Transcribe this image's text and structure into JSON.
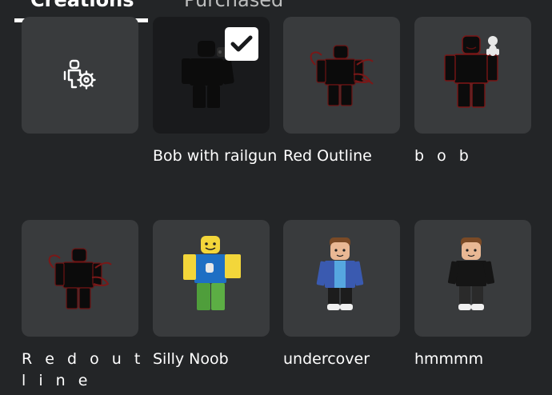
{
  "tabs": [
    {
      "label": "Creations"
    },
    {
      "label": "Purchased"
    }
  ],
  "items": [
    {
      "label": "",
      "icon": "accessory-settings-icon"
    },
    {
      "label": "Bob with railgun",
      "selected": true
    },
    {
      "label": "Red Outline"
    },
    {
      "label": "b o b"
    },
    {
      "label": "R e d  o u t l i n e"
    },
    {
      "label": "Silly Noob"
    },
    {
      "label": "undercover"
    },
    {
      "label": "hmmmm"
    }
  ],
  "colors": {
    "background": "#232527",
    "tile": "#393b3d",
    "tile_selected": "#191a1c",
    "text": "#ffffff"
  }
}
